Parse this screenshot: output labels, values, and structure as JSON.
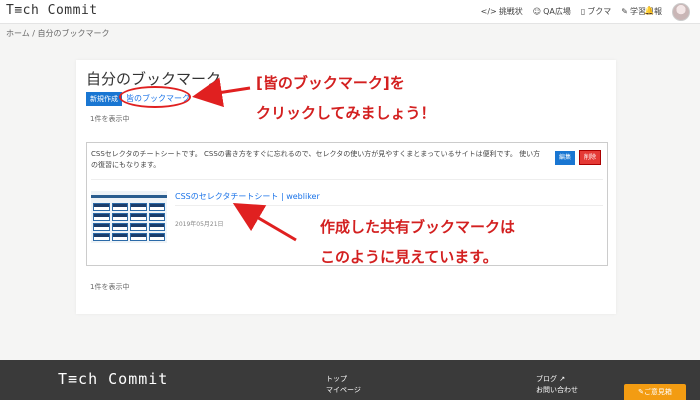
{
  "nav": {
    "logo": "T≡ch Commit",
    "links": [
      {
        "icon": "code-icon",
        "glyph": "</>",
        "label": "挑戦状"
      },
      {
        "icon": "qa-icon",
        "glyph": "☺",
        "label": "QA広場"
      },
      {
        "icon": "bookmark-icon",
        "glyph": "▯",
        "label": "ブクマ"
      },
      {
        "icon": "pencil-icon",
        "glyph": "✎",
        "label": "学習日報"
      }
    ],
    "bell_glyph": "🔔"
  },
  "breadcrumb": "ホーム / 自分のブックマーク",
  "page": {
    "title": "自分のブックマーク",
    "new_button": "新規作成",
    "all_bookmarks_link": "皆のブックマーク",
    "count_top": "1件を表示中",
    "count_bottom": "1件を表示中"
  },
  "entry": {
    "description": "CSSセレクタのチートシートです。 CSSの書き方をすぐに忘れるので、セレクタの使い方が見やすくまとまっているサイトは便利です。 使い方の復習にもなります。",
    "edit_button": "編集",
    "delete_button": "削除",
    "title": "CSSのセレクタチートシート | webliker",
    "date": "2019年05月21日"
  },
  "annotations": {
    "top_line1": "[皆のブックマーク]を",
    "top_line2": "クリックしてみましょう！",
    "bottom_line1": "作成した共有ブックマークは",
    "bottom_line2": "このように見えています。"
  },
  "footer": {
    "logo": "T≡ch Commit",
    "col1": [
      "トップ",
      "マイページ"
    ],
    "col2": [
      "ブログ ↗",
      "お問い合わせ"
    ],
    "feedback_button": "✎ご意見箱"
  },
  "colors": {
    "accent": "#1976d2",
    "danger": "#e53935",
    "annotation": "#d32020",
    "footer_bg": "#3a3a3a",
    "feedback": "#f39c12"
  }
}
